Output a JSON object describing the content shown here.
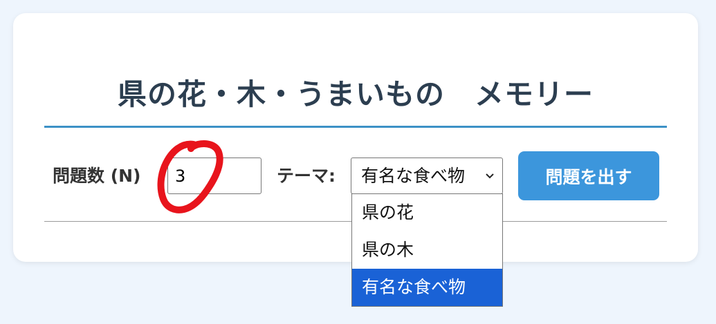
{
  "header": {
    "title": "県の花・木・うまいもの　メモリー"
  },
  "controls": {
    "count_label": "問題数 (N)",
    "count_value": "3",
    "theme_label": "テーマ:",
    "theme_selected": "有名な食べ物",
    "theme_options": [
      "県の花",
      "県の木",
      "有名な食べ物"
    ],
    "submit_label": "問題を出す"
  },
  "colors": {
    "page_background": "#eef5fd",
    "accent": "#3c91c6",
    "button": "#3c96dc",
    "selected_option": "#1a62d6",
    "annotation": "#e8141c"
  },
  "icons": {
    "select_chevron": "chevron-down-icon",
    "annotation": "red-circle-annotation"
  }
}
